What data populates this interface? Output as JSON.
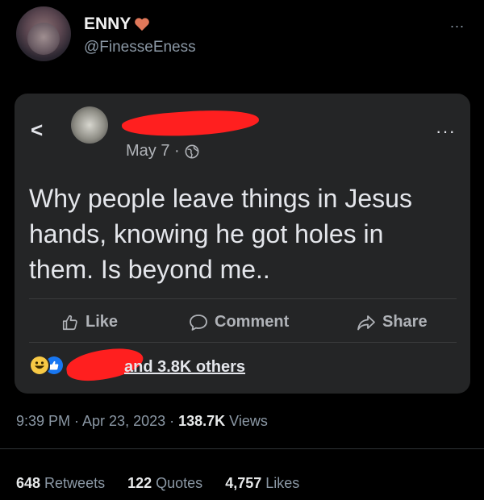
{
  "tweet": {
    "display_name": "ENNY",
    "handle": "@FinesseEness",
    "more": "...",
    "timestamp": "9:39 PM · Apr 23, 2023 · ",
    "views_count": "138.7K",
    "views_label": " Views",
    "stats": {
      "retweets_count": "648",
      "retweets_label": " Retweets",
      "quotes_count": "122",
      "quotes_label": " Quotes",
      "likes_count": "4,757",
      "likes_label": " Likes"
    }
  },
  "embedded_post": {
    "date": "May 7 ·",
    "more": "···",
    "text": "Why people leave things in Jesus hands, knowing he got holes in them. Is beyond me..",
    "actions": {
      "like": "Like",
      "comment": "Comment",
      "share": "Share"
    },
    "others_text": "and 3.8K others"
  },
  "colors": {
    "background": "#000000",
    "card": "#242526",
    "redaction": "#ff1f1f",
    "heart": "#e0785a",
    "like_blue": "#1877f2"
  }
}
